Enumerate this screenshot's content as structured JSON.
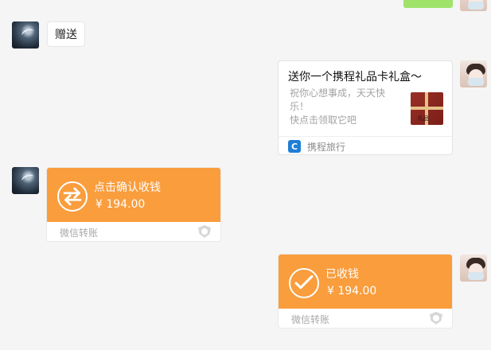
{
  "messages": {
    "gift_text": "赠送",
    "gift_card": {
      "title": "送你一个携程礼品卡礼盒～",
      "desc_lines": [
        "祝你心想事成，天天快",
        "乐！",
        "快点击领取它吧"
      ],
      "thumb_text": "礼品",
      "app_name": "携程旅行",
      "app_icon_text": "C"
    },
    "transfer_receive": {
      "title": "点击确认收钱",
      "amount": "¥ 194.00",
      "footer": "微信转账"
    },
    "transfer_received": {
      "title": "已收钱",
      "amount": "¥ 194.00",
      "footer": "微信转账"
    }
  },
  "colors": {
    "transfer_orange": "#f99d3d",
    "green_bubble": "#9fe36b",
    "ctrip_blue": "#1f7ed6",
    "background": "#f5f5f5"
  },
  "icons": {
    "left_avatar": "bird-avatar",
    "right_avatar": "person-avatar",
    "transfer_arrows": "transfer-arrows-icon",
    "transfer_check": "check-icon",
    "shield": "shield-icon"
  }
}
